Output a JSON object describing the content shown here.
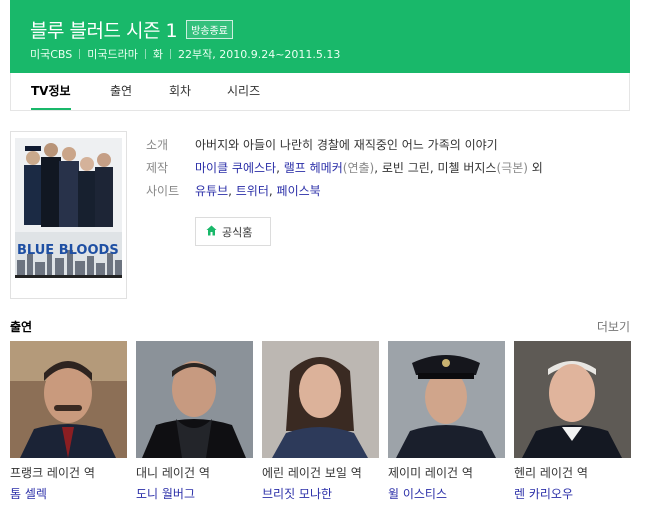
{
  "header": {
    "title": "블루 블러드 시즌 1",
    "badge": "방송종료",
    "meta": [
      "미국CBS",
      "미국드라마",
      "화",
      "22부작, 2010.9.24~2011.5.13"
    ]
  },
  "tabs": [
    {
      "label": "TV정보",
      "active": true
    },
    {
      "label": "출연",
      "active": false
    },
    {
      "label": "회차",
      "active": false
    },
    {
      "label": "시리즈",
      "active": false
    }
  ],
  "poster": {
    "logo_text": "BLUE BLOODS"
  },
  "info": {
    "synopsis_label": "소개",
    "synopsis": "아버지와 아들이 나란히 경찰에 재직중인 어느 가족의 이야기",
    "production_label": "제작",
    "production": {
      "p1": "마이클 쿠에스타",
      "s1": ", ",
      "p2": "랠프 헤메커",
      "r2": "(연출)",
      "s2": ", 로빈 그린, 미첼 버지스",
      "r3": "(극본)",
      "s3": " 외"
    },
    "sites_label": "사이트",
    "sites": [
      "유튜브",
      "트위터",
      "페이스북"
    ],
    "homepage_label": "공식홈"
  },
  "cast": {
    "title": "출연",
    "more_label": "더보기",
    "members": [
      {
        "role": "프랭크 레이건 역",
        "name": "톰 셀렉"
      },
      {
        "role": "대니 레이건 역",
        "name": "도니 월버그"
      },
      {
        "role": "에린 레이건 보일 역",
        "name": "브리짓 모나한"
      },
      {
        "role": "제이미 레이건 역",
        "name": "윌 이스티스"
      },
      {
        "role": "헨리 레이건 역",
        "name": "렌 카리오우"
      }
    ]
  },
  "colors": {
    "brand_green": "#19b86a",
    "link_blue": "#2b2fa8"
  }
}
